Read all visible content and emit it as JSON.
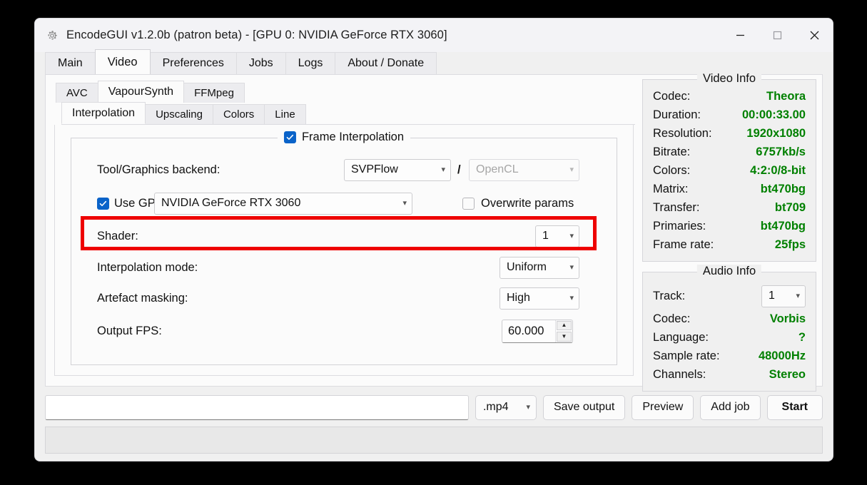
{
  "window": {
    "title": "EncodeGUI v1.2.0b (patron beta) - [GPU 0: NVIDIA GeForce RTX 3060]",
    "app_icon": "gear-icon",
    "minimize": "—",
    "maximize": "□",
    "close": "✕"
  },
  "main_tabs": [
    {
      "label": "Main",
      "active": false
    },
    {
      "label": "Video",
      "active": true
    },
    {
      "label": "Preferences",
      "active": false
    },
    {
      "label": "Jobs",
      "active": false
    },
    {
      "label": "Logs",
      "active": false
    },
    {
      "label": "About / Donate",
      "active": false
    }
  ],
  "sub_tabs_1": [
    {
      "label": "AVC",
      "active": false
    },
    {
      "label": "VapourSynth",
      "active": true
    },
    {
      "label": "FFMpeg",
      "active": false
    }
  ],
  "sub_tabs_2": [
    {
      "label": "Interpolation",
      "active": true
    },
    {
      "label": "Upscaling",
      "active": false
    },
    {
      "label": "Colors",
      "active": false
    },
    {
      "label": "Line",
      "active": false
    }
  ],
  "frame_interpolation": {
    "legend": "Frame Interpolation",
    "enabled_checkbox": "checked",
    "backend": {
      "label": "Tool/Graphics backend:",
      "tool_value": "SVPFlow",
      "separator": "/",
      "graphics_value": "OpenCL",
      "graphics_disabled": true
    },
    "gpu": {
      "checkbox": "checked",
      "label": "Use GPU:",
      "value": "NVIDIA GeForce RTX 3060"
    },
    "overwrite": {
      "checkbox": "unchecked",
      "label": "Overwrite params"
    },
    "shader": {
      "label": "Shader:",
      "value": "1",
      "highlighted": true,
      "highlight_color": "#ee0000"
    },
    "interpolation_mode": {
      "label": "Interpolation mode:",
      "value": "Uniform"
    },
    "artefact_masking": {
      "label": "Artefact masking:",
      "value": "High"
    },
    "output_fps": {
      "label": "Output FPS:",
      "value": "60.000",
      "up": "▲",
      "down": "▼"
    }
  },
  "video_info": {
    "legend": "Video Info",
    "value_color": "#008000",
    "rows": [
      {
        "key": "Codec:",
        "value": "Theora"
      },
      {
        "key": "Duration:",
        "value": "00:00:33.00"
      },
      {
        "key": "Resolution:",
        "value": "1920x1080"
      },
      {
        "key": "Bitrate:",
        "value": "6757kb/s"
      },
      {
        "key": "Colors:",
        "value": "4:2:0/8-bit"
      },
      {
        "key": "Matrix:",
        "value": "bt470bg"
      },
      {
        "key": "Transfer:",
        "value": "bt709"
      },
      {
        "key": "Primaries:",
        "value": "bt470bg"
      },
      {
        "key": "Frame rate:",
        "value": "25fps"
      }
    ]
  },
  "audio_info": {
    "legend": "Audio Info",
    "track_label": "Track:",
    "track_value": "1",
    "rows": [
      {
        "key": "Codec:",
        "value": "Vorbis"
      },
      {
        "key": "Language:",
        "value": "?"
      },
      {
        "key": "Sample rate:",
        "value": "48000Hz"
      },
      {
        "key": "Channels:",
        "value": "Stereo"
      }
    ]
  },
  "bottom_bar": {
    "path_value": "",
    "path_placeholder": "",
    "extension": ".mp4",
    "save_output": "Save output",
    "preview": "Preview",
    "add_job": "Add job",
    "start": "Start"
  },
  "status_bar": {
    "text": ""
  }
}
